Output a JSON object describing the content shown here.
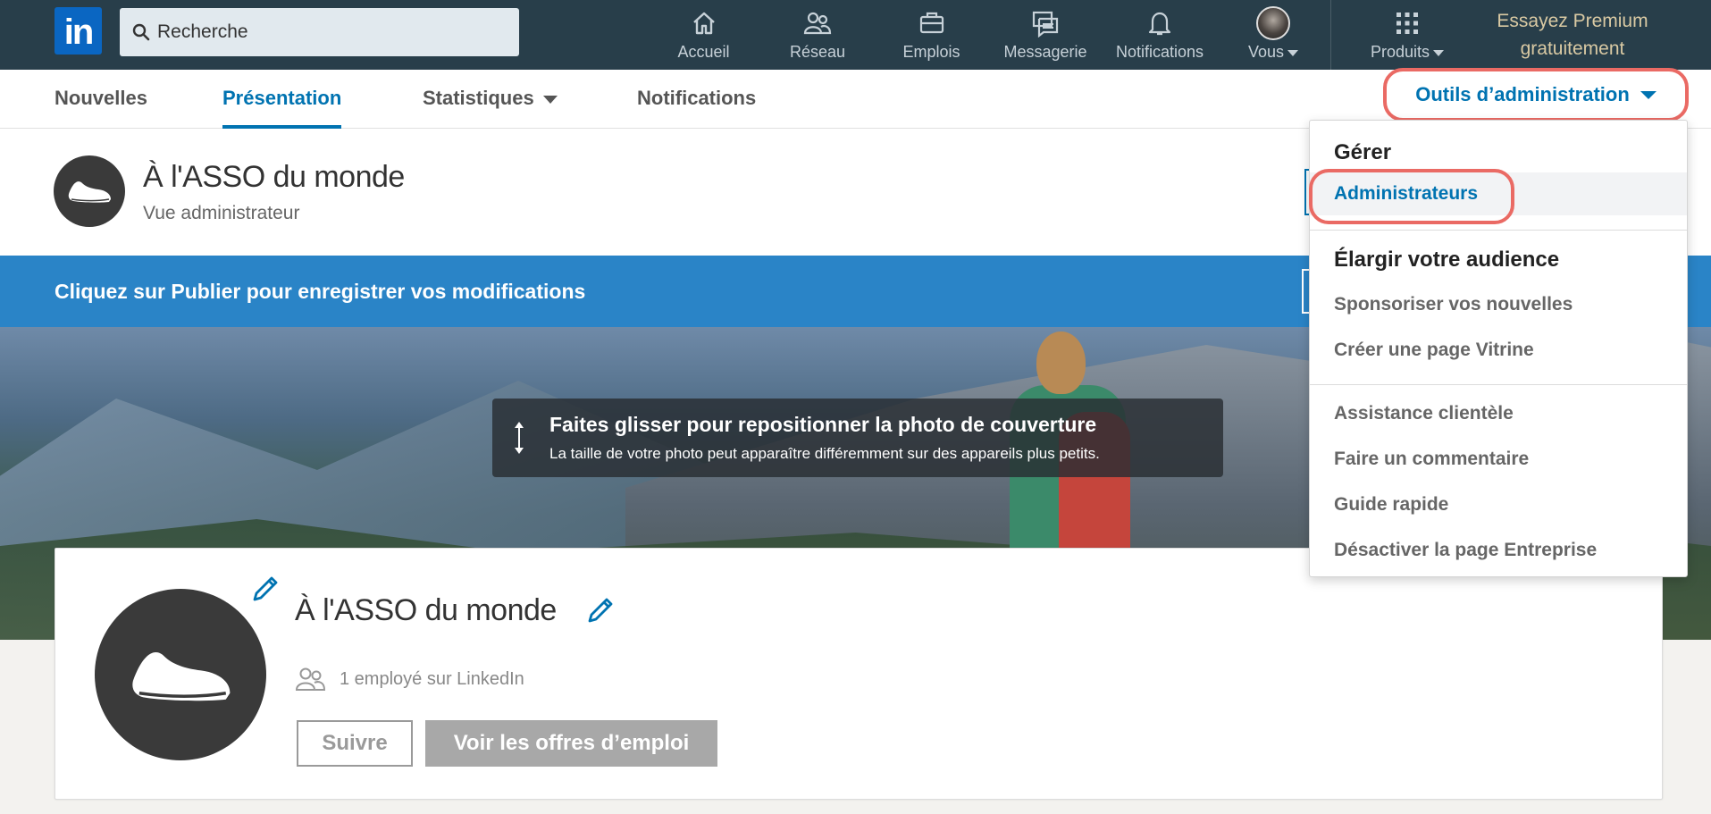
{
  "topnav": {
    "logo": "in",
    "search": {
      "placeholder": "Recherche"
    },
    "items": [
      {
        "label": "Accueil",
        "icon": "home-icon"
      },
      {
        "label": "Réseau",
        "icon": "network-icon"
      },
      {
        "label": "Emplois",
        "icon": "briefcase-icon"
      },
      {
        "label": "Messagerie",
        "icon": "messaging-icon"
      },
      {
        "label": "Notifications",
        "icon": "bell-icon"
      },
      {
        "label": "Vous",
        "icon": "avatar"
      }
    ],
    "products": "Produits",
    "premium_line1": "Essayez Premium",
    "premium_line2": "gratuitement"
  },
  "subnav": {
    "tabs": [
      "Nouvelles",
      "Présentation",
      "Statistiques",
      "Notifications"
    ],
    "active_tab": "Présentation",
    "admin_tools": "Outils d’administration"
  },
  "header": {
    "title": "À l'ASSO du monde",
    "subtitle": "Vue administrateur"
  },
  "banner": {
    "text": "Cliquez sur Publier pour enregistrer vos modifications"
  },
  "cover": {
    "tooltip_title": "Faites glisser pour repositionner la photo de couverture",
    "tooltip_sub": "La taille de votre photo peut apparaître différemment sur des appareils plus petits."
  },
  "card": {
    "title": "À l'ASSO du monde",
    "employees": "1 employé sur LinkedIn",
    "follow": "Suivre",
    "jobs": "Voir les offres d’emploi"
  },
  "dropdown": {
    "manage_heading": "Gérer",
    "administrators": "Administrateurs",
    "audience_heading": "Élargir votre audience",
    "sponsor": "Sponsoriser vos nouvelles",
    "showcase": "Créer une page Vitrine",
    "support": "Assistance clientèle",
    "feedback": "Faire un commentaire",
    "guide": "Guide rapide",
    "deactivate": "Désactiver la page Entreprise"
  },
  "colors": {
    "nav_bg": "#283e4a",
    "brand_blue": "#0073b1",
    "banner_blue": "#2a84c7",
    "highlight_ring": "#ea6a64"
  }
}
